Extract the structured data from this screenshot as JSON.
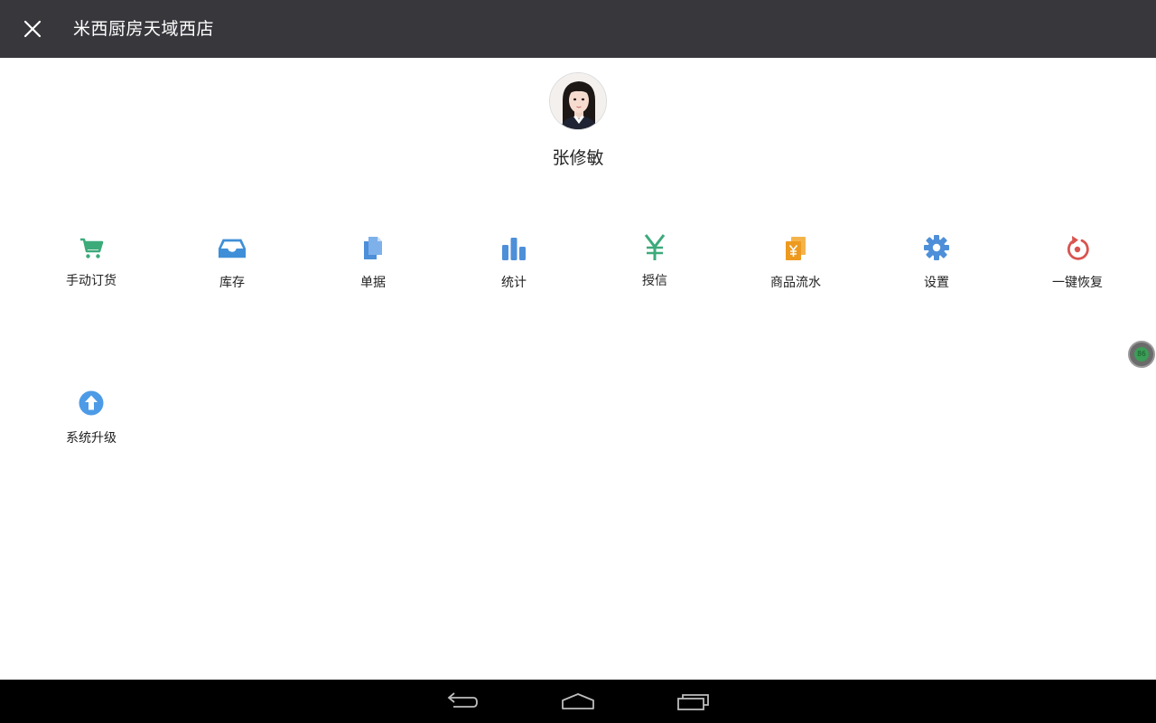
{
  "app": {
    "title": "米西厨房天域西店",
    "close_icon": "close-icon"
  },
  "profile": {
    "name": "张修敏",
    "avatar_icon": "avatar-photo"
  },
  "menu": [
    {
      "label": "手动订货",
      "icon": "cart-icon",
      "color": "#3daa7a"
    },
    {
      "label": "库存",
      "icon": "inbox-tray-icon",
      "color": "#3f8fd8"
    },
    {
      "label": "单据",
      "icon": "documents-icon",
      "color": "#4d8fd8"
    },
    {
      "label": "统计",
      "icon": "bar-chart-icon",
      "color": "#4d8fd8"
    },
    {
      "label": "授信",
      "icon": "yen-icon",
      "color": "#3daa7a"
    },
    {
      "label": "商品流水",
      "icon": "yen-cards-icon",
      "color": "#f0a030"
    },
    {
      "label": "设置",
      "icon": "gear-icon",
      "color": "#4d8fd8"
    },
    {
      "label": "一键恢复",
      "icon": "restore-icon",
      "color": "#d9534f"
    },
    {
      "label": "系统升级",
      "icon": "upgrade-arrow-icon",
      "color": "#4d9be6"
    }
  ],
  "floating_ball": {
    "text": "86",
    "icon": "floating-assistant-icon"
  },
  "system_nav": {
    "back_icon": "back-icon",
    "home_icon": "home-icon",
    "recents_icon": "recents-icon"
  }
}
